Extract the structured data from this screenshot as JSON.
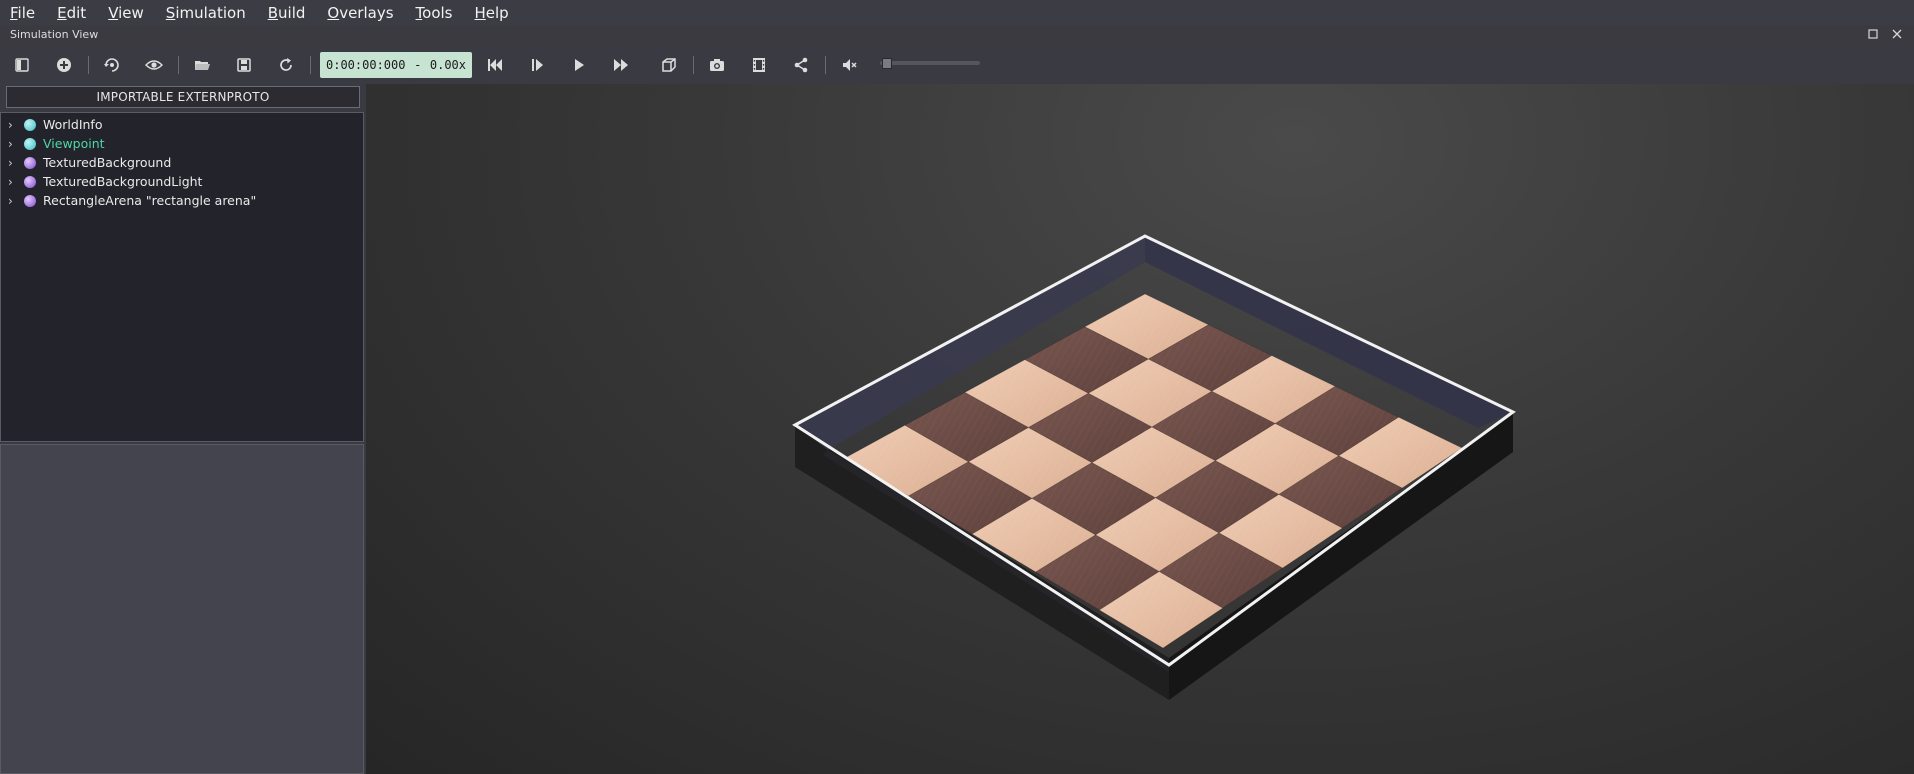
{
  "menu": [
    {
      "key": "F",
      "rest": "ile"
    },
    {
      "key": "E",
      "rest": "dit"
    },
    {
      "key": "V",
      "rest": "iew"
    },
    {
      "key": "S",
      "rest": "imulation"
    },
    {
      "key": "B",
      "rest": "uild"
    },
    {
      "key": "O",
      "rest": "verlays"
    },
    {
      "key": "T",
      "rest": "ools"
    },
    {
      "key": "H",
      "rest": "elp"
    }
  ],
  "dock": {
    "title": "Simulation View"
  },
  "toolbar": {
    "time": "0:00:00:000",
    "separator": "-",
    "speed": "0.00x"
  },
  "scene_tree": {
    "extern_button": "IMPORTABLE EXTERNPROTO",
    "items": [
      {
        "label": "WorldInfo",
        "color": "#6fd3d8",
        "selected": false
      },
      {
        "label": "Viewpoint",
        "color": "#6fd3d8",
        "selected": true
      },
      {
        "label": "TexturedBackground",
        "color": "#a77de0",
        "selected": false
      },
      {
        "label": "TexturedBackgroundLight",
        "color": "#a77de0",
        "selected": false
      },
      {
        "label": "RectangleArena \"rectangle arena\"",
        "color": "#a77de0",
        "selected": false
      }
    ]
  },
  "colors": {
    "selected_text": "#4fd6a6",
    "time_box_bg": "#c7e4d3",
    "tile_light": "#e7c1a6",
    "tile_dark": "#6e4b45"
  }
}
